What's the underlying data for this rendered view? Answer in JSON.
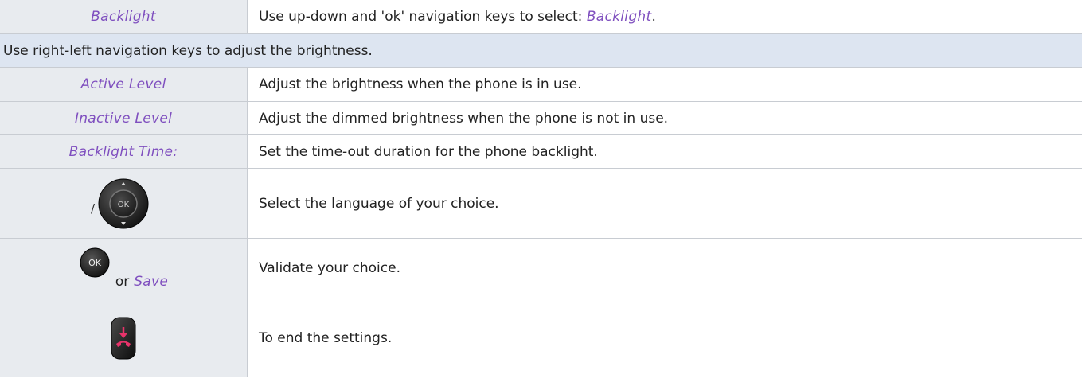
{
  "rows": [
    {
      "left": "Backlight",
      "right_prefix": "Use up-down and 'ok' navigation keys to select: ",
      "right_em": "Backlight",
      "right_suffix": "."
    },
    {
      "full": "Use right-left navigation keys to adjust the brightness."
    },
    {
      "left": "Active Level",
      "right": "Adjust the brightness when the phone is in use."
    },
    {
      "left": "Inactive Level",
      "right": "Adjust the dimmed brightness when the phone is not in use."
    },
    {
      "left": "Backlight Time:",
      "right": "Set the time-out duration for the phone backlight."
    },
    {
      "icon": "navigation-pad-icon",
      "slash": "/",
      "right": "Select the language of your choice."
    },
    {
      "icon": "ok-key-icon",
      "or": "or",
      "save": "Save",
      "right": "Validate your choice."
    },
    {
      "icon": "end-call-key-icon",
      "right": "To end the settings."
    }
  ],
  "icons": {
    "ok_label": "OK",
    "nav_ok_label": "OK"
  },
  "colors": {
    "accent": "#7f4fbf",
    "left_bg": "#e8ebef",
    "header_bg": "#dde5f1",
    "end_key": "#e8336a"
  }
}
